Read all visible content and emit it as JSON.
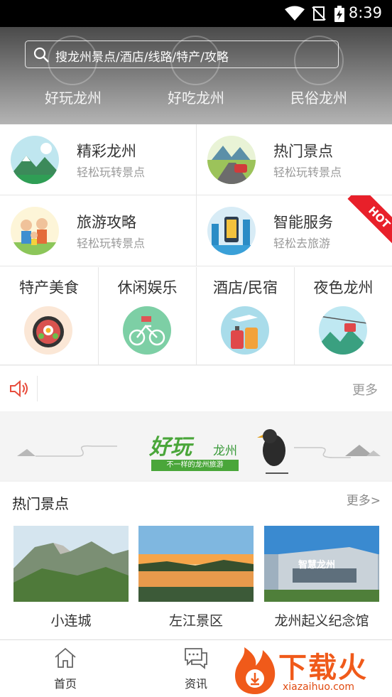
{
  "status_bar": {
    "time": "8:39"
  },
  "hero": {
    "search_placeholder": "搜龙州景点/酒店/线路/特产/攻略",
    "categories": [
      "好玩龙州",
      "好吃龙州",
      "民俗龙州"
    ]
  },
  "feature_tiles": [
    {
      "title": "精彩龙州",
      "subtitle": "轻松玩转景点",
      "icon": "mountain-icon"
    },
    {
      "title": "热门景点",
      "subtitle": "轻松玩转景点",
      "icon": "road-trip-icon"
    },
    {
      "title": "旅游攻略",
      "subtitle": "轻松玩转景点",
      "icon": "family-icon"
    },
    {
      "title": "智能服务",
      "subtitle": "轻松去旅游",
      "icon": "smart-city-icon",
      "badge": "HOT"
    }
  ],
  "service_columns": [
    {
      "label": "特产美食",
      "icon": "food-bowl-icon"
    },
    {
      "label": "休闲娱乐",
      "icon": "bicycle-icon"
    },
    {
      "label": "酒店/民宿",
      "icon": "luggage-icon"
    },
    {
      "label": "夜色龙州",
      "icon": "cable-car-icon"
    }
  ],
  "notice": {
    "more_label": "更多"
  },
  "banner": {
    "title_main": "好玩",
    "title_sub": "龙州",
    "tagline": "不一样的龙州旅游"
  },
  "hot_scenic": {
    "heading": "热门景点",
    "more_label": "更多>",
    "items": [
      {
        "name": "小连城"
      },
      {
        "name": "左江景区"
      },
      {
        "name": "龙州起义纪念馆",
        "photo_text": "智慧龙州"
      }
    ]
  },
  "bottom_nav": [
    {
      "label": "首页",
      "icon": "home-icon"
    },
    {
      "label": "资讯",
      "icon": "chat-icon"
    }
  ],
  "watermark": {
    "text": "下载火",
    "url": "xiazaihuo.com"
  },
  "colors": {
    "hot_red": "#e8202a",
    "brand_green": "#4aa63a",
    "watermark_orange": "#f05a1a"
  }
}
